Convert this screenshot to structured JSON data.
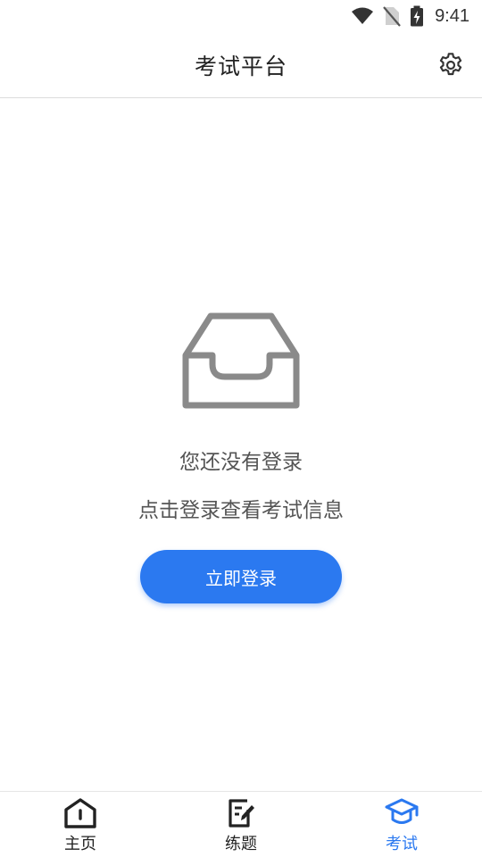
{
  "status_bar": {
    "time": "9:41",
    "icons": [
      "wifi-icon",
      "no-sim-icon",
      "battery-charging-icon"
    ]
  },
  "header": {
    "title": "考试平台",
    "settings_icon": "gear-icon"
  },
  "empty_state": {
    "icon": "inbox-icon",
    "message": "您还没有登录",
    "hint": "点击登录查看考试信息",
    "login_button": "立即登录"
  },
  "bottom_nav": {
    "items": [
      {
        "label": "主页",
        "icon": "home-icon",
        "active": false
      },
      {
        "label": "练题",
        "icon": "edit-note-icon",
        "active": false
      },
      {
        "label": "考试",
        "icon": "graduation-cap-icon",
        "active": true
      }
    ]
  },
  "colors": {
    "accent": "#2b79f0",
    "text": "#222222",
    "muted": "#555555",
    "icon_gray": "#8a8a8a"
  }
}
